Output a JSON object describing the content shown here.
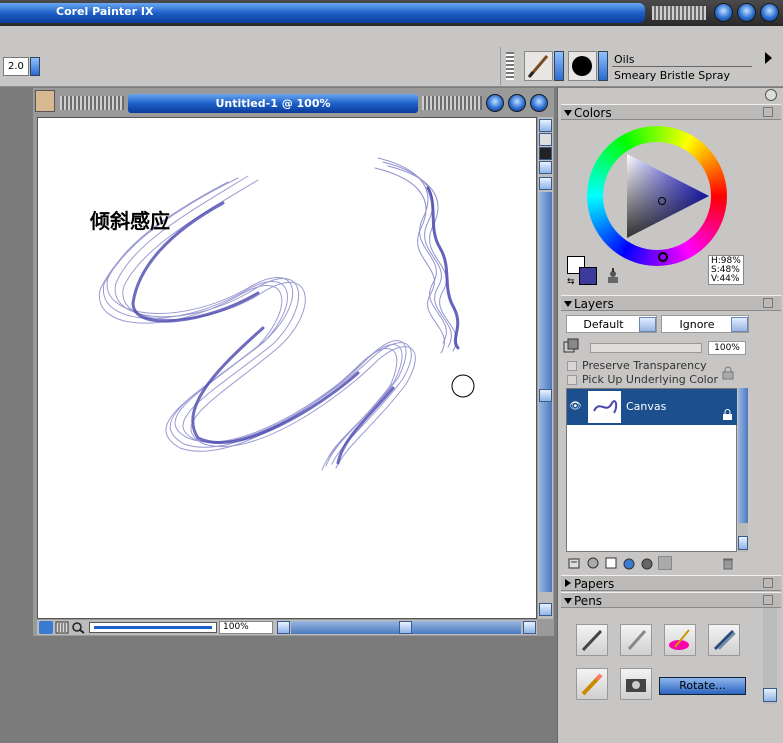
{
  "app": {
    "title": "Corel Painter IX"
  },
  "property_bar": {
    "brush_size": "2.0",
    "brush_category": "Oils",
    "brush_variant": "Smeary Bristle Spray"
  },
  "document": {
    "title": "Untitled-1 @ 100%",
    "canvas_text": "倾斜感应",
    "zoom": "100%"
  },
  "colors": {
    "title": "Colors",
    "hsv": {
      "h": "H:98%",
      "s": "S:48%",
      "v": "V:44%"
    },
    "primary": "#3c3a9a",
    "secondary": "#ffffff",
    "stroke_color": "#4a48b0"
  },
  "layers": {
    "title": "Layers",
    "composite_method": "Default",
    "composite_depth": "Ignore",
    "opacity": "100%",
    "preserve_transparency": "Preserve Transparency",
    "pick_up_underlying": "Pick Up Underlying Color",
    "items": [
      {
        "name": "Canvas",
        "selected": true
      }
    ]
  },
  "papers": {
    "title": "Papers"
  },
  "pens": {
    "title": "Pens",
    "rotate_label": "Rotate..."
  },
  "accent": "#1d5fc8"
}
